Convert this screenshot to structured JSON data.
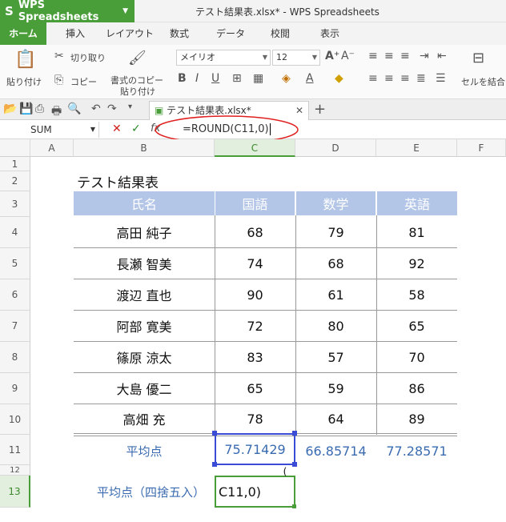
{
  "app": {
    "name": "WPS Spreadsheets",
    "window_title": "テスト結果表.xlsx* - WPS Spreadsheets"
  },
  "ribbon_tabs": [
    "ホーム",
    "挿入",
    "レイアウト",
    "数式",
    "データ",
    "校閲",
    "表示"
  ],
  "ribbon": {
    "paste": "貼り付け",
    "cut": "切り取り",
    "copy": "コピー",
    "format_painter_1": "書式のコピー",
    "format_painter_2": "貼り付け",
    "font_name": "メイリオ",
    "font_size": "12",
    "merge": "セルを結合"
  },
  "doc_tab": {
    "name": "テスト結果表.xlsx*"
  },
  "formula_bar": {
    "name_box": "SUM",
    "fx": "fx",
    "formula": "=ROUND(C11,0)"
  },
  "columns": [
    "A",
    "B",
    "C",
    "D",
    "E",
    "F"
  ],
  "rows": [
    "1",
    "2",
    "3",
    "4",
    "5",
    "6",
    "7",
    "8",
    "9",
    "10",
    "11",
    "12",
    "13"
  ],
  "sheet": {
    "title": "テスト結果表",
    "headers": [
      "氏名",
      "国語",
      "数学",
      "英語"
    ],
    "records": [
      {
        "name": "高田 純子",
        "kokugo": "68",
        "sugaku": "79",
        "eigo": "81"
      },
      {
        "name": "長瀬 智美",
        "kokugo": "74",
        "sugaku": "68",
        "eigo": "92"
      },
      {
        "name": "渡辺 直也",
        "kokugo": "90",
        "sugaku": "61",
        "eigo": "58"
      },
      {
        "name": "阿部 寛美",
        "kokugo": "72",
        "sugaku": "80",
        "eigo": "65"
      },
      {
        "name": "篠原 涼太",
        "kokugo": "83",
        "sugaku": "57",
        "eigo": "70"
      },
      {
        "name": "大島 優二",
        "kokugo": "65",
        "sugaku": "59",
        "eigo": "86"
      },
      {
        "name": "高畑 充",
        "kokugo": "78",
        "sugaku": "64",
        "eigo": "89"
      }
    ],
    "average_label": "平均点",
    "averages": [
      "75.71429",
      "66.85714",
      "77.28571"
    ],
    "rounded_label": "平均点（四捨五入）",
    "editing_cell": "C11,0)",
    "tooltip_fragment": "("
  },
  "colors": {
    "accent": "#4a9e3a",
    "header_fill": "#b4c6e7",
    "avg_text": "#3a6bb0",
    "selection": "#3a4cd6",
    "annotation": "#e02020"
  }
}
